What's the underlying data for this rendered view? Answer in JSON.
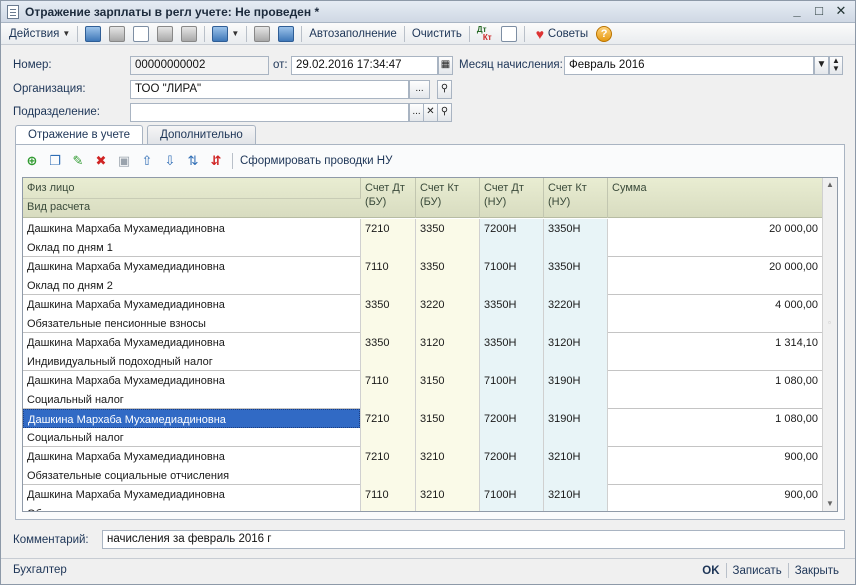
{
  "window": {
    "title": "Отражение зарплаты в регл учете: Не проведен *",
    "minimize": "_",
    "maximize": "□",
    "close": "✕"
  },
  "toolbar": {
    "actions": "Действия",
    "autofill": "Автозаполнение",
    "clear": "Очистить",
    "dtkt_top": "Дт",
    "dtkt_bottom": "Кт",
    "tips": "Советы",
    "help": "?"
  },
  "form": {
    "number_label": "Номер:",
    "number_value": "00000000002",
    "date_label": "от:",
    "date_value": "29.02.2016 17:34:47",
    "month_label": "Месяц начисления:",
    "month_value": "Февраль 2016",
    "org_label": "Организация:",
    "org_value": "ТОО \"ЛИРА\"",
    "dept_label": "Подразделение:",
    "dept_value": "",
    "comment_label": "Комментарий:",
    "comment_value": "начисления за февраль 2016 г"
  },
  "tabs": [
    {
      "label": "Отражение в учете"
    },
    {
      "label": "Дополнительно"
    }
  ],
  "inner_toolbar": {
    "generate": "Сформировать проводки НУ"
  },
  "grid": {
    "headers": {
      "person": "Физ лицо",
      "calc_type": "Вид расчета",
      "dt_bu": "Счет Дт (БУ)",
      "kt_bu": "Счет Кт (БУ)",
      "dt_nu": "Счет Дт (НУ)",
      "kt_nu": "Счет Кт (НУ)",
      "sum": "Сумма"
    },
    "rows": [
      {
        "person": "Дашкина Мархаба Мухамедиадиновна",
        "calc": "Оклад по дням 1",
        "dt_bu": "7210",
        "kt_bu": "3350",
        "dt_nu": "7200Н",
        "kt_nu": "3350Н",
        "sum": "20 000,00"
      },
      {
        "person": "Дашкина Мархаба Мухамедиадиновна",
        "calc": "Оклад по дням 2",
        "dt_bu": "7110",
        "kt_bu": "3350",
        "dt_nu": "7100Н",
        "kt_nu": "3350Н",
        "sum": "20 000,00"
      },
      {
        "person": "Дашкина Мархаба Мухамедиадиновна",
        "calc": "Обязательные пенсионные взносы",
        "dt_bu": "3350",
        "kt_bu": "3220",
        "dt_nu": "3350Н",
        "kt_nu": "3220Н",
        "sum": "4 000,00"
      },
      {
        "person": "Дашкина Мархаба Мухамедиадиновна",
        "calc": "Индивидуальный подоходный налог",
        "dt_bu": "3350",
        "kt_bu": "3120",
        "dt_nu": "3350Н",
        "kt_nu": "3120Н",
        "sum": "1 314,10"
      },
      {
        "person": "Дашкина Мархаба Мухамедиадиновна",
        "calc": "Социальный налог",
        "dt_bu": "7110",
        "kt_bu": "3150",
        "dt_nu": "7100Н",
        "kt_nu": "3190Н",
        "sum": "1 080,00"
      },
      {
        "person": "Дашкина Мархаба Мухамедиадиновна",
        "calc": "Социальный налог",
        "dt_bu": "7210",
        "kt_bu": "3150",
        "dt_nu": "7200Н",
        "kt_nu": "3190Н",
        "sum": "1 080,00"
      },
      {
        "person": "Дашкина Мархаба Мухамедиадиновна",
        "calc": "Обязательные социальные отчисления",
        "dt_bu": "7210",
        "kt_bu": "3210",
        "dt_nu": "7200Н",
        "kt_nu": "3210Н",
        "sum": "900,00"
      },
      {
        "person": "Дашкина Мархаба Мухамедиадиновна",
        "calc": "Об",
        "dt_bu": "7110",
        "kt_bu": "3210",
        "dt_nu": "7100Н",
        "kt_nu": "3210Н",
        "sum": "900,00"
      }
    ]
  },
  "footer": {
    "author": "Бухгалтер",
    "ok": "OK",
    "save": "Записать",
    "close": "Закрыть"
  },
  "colors": {
    "selection": "#316ac5",
    "bu_column": "#fafae8",
    "nu_column": "#e8f4f7"
  }
}
